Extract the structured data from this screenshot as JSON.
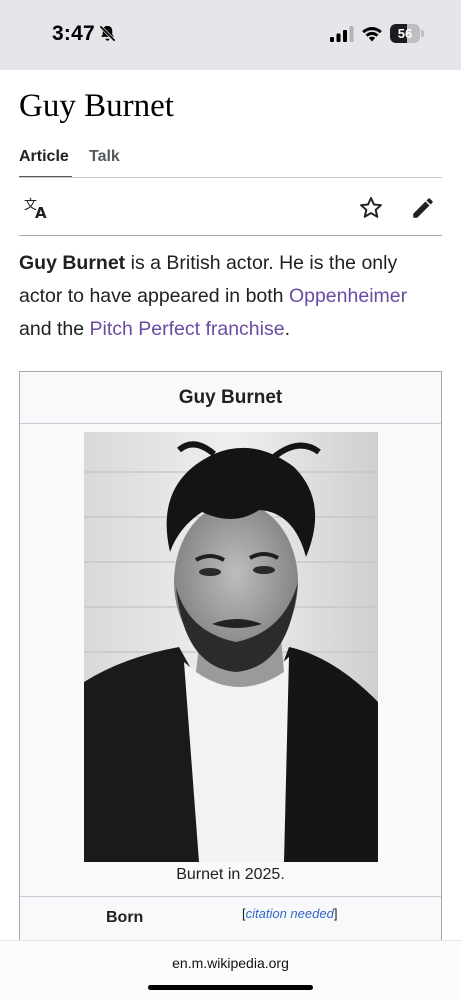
{
  "status_bar": {
    "time": "3:47",
    "battery_level": "56",
    "battery_fraction": 0.56,
    "icons": [
      "bell-slash-icon",
      "cellular-signal-icon",
      "wifi-icon",
      "battery-icon"
    ]
  },
  "article": {
    "title": "Guy Burnet",
    "tabs": [
      {
        "label": "Article",
        "selected": true
      },
      {
        "label": "Talk",
        "selected": false
      }
    ],
    "toolbar_icons": [
      "language-icon",
      "watch-star-icon",
      "edit-pencil-icon"
    ],
    "intro": {
      "subject": "Guy Burnet",
      "text_1": " is a British actor. He is the only actor to have appeared in both ",
      "link_1": "Oppenheimer",
      "text_2": " and the ",
      "link_2": "Pitch Perfect franchise",
      "text_3": "."
    }
  },
  "infobox": {
    "title": "Guy Burnet",
    "photo_description_icon": "portrait-photo",
    "caption": "Burnet in 2025.",
    "born_label": "Born",
    "citation_open": "[",
    "citation_text": "citation needed",
    "citation_close": "]"
  },
  "browser": {
    "url": "en.m.wikipedia.org"
  },
  "colors": {
    "link": "#6b4ba1",
    "citation_link": "#3366cc",
    "text": "#202122",
    "status_bar_bg": "#e5e6e9"
  }
}
